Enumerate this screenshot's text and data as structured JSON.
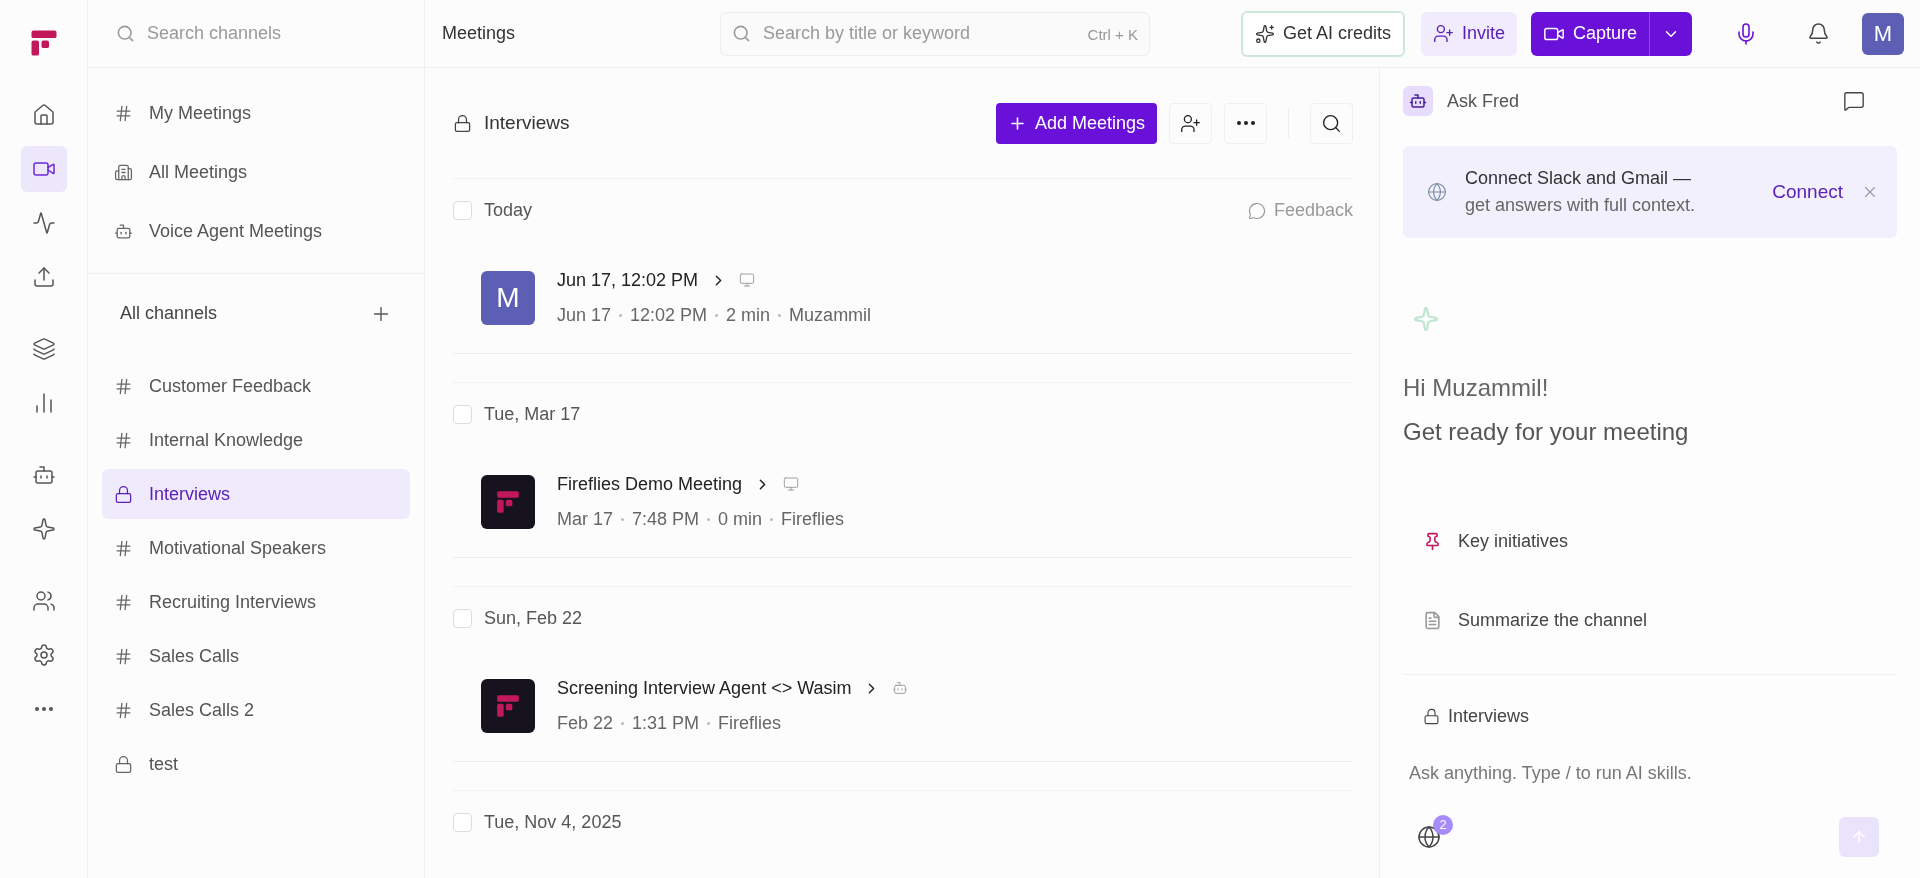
{
  "rail": [
    [
      {
        "kind": "home",
        "selected": false
      },
      {
        "kind": "video",
        "selected": true
      },
      {
        "kind": "activity",
        "selected": false
      },
      {
        "kind": "upload",
        "selected": false
      }
    ],
    [
      {
        "kind": "layers",
        "selected": false
      },
      {
        "kind": "chart",
        "selected": false
      }
    ],
    [
      {
        "kind": "bot",
        "selected": false
      },
      {
        "kind": "sparkle",
        "selected": false
      }
    ],
    [
      {
        "kind": "users",
        "selected": false
      },
      {
        "kind": "settings",
        "selected": false
      },
      {
        "kind": "more",
        "selected": false
      }
    ]
  ],
  "channel_search": {
    "placeholder": "Search channels"
  },
  "page_title": "Meetings",
  "search": {
    "placeholder": "Search by title or keyword",
    "shortcut": "Ctrl + K"
  },
  "top_actions": {
    "credits": "Get AI credits",
    "invite": "Invite",
    "capture": "Capture",
    "avatar": "M"
  },
  "sidebar": {
    "top_items": [
      {
        "kind": "hash",
        "label": "My Meetings",
        "selected": false
      },
      {
        "kind": "building",
        "label": "All Meetings",
        "selected": false
      },
      {
        "kind": "bot",
        "label": "Voice Agent Meetings",
        "selected": false
      }
    ],
    "channels_heading": "All channels",
    "channels": [
      {
        "kind": "hash",
        "label": "Customer Feedback",
        "selected": false
      },
      {
        "kind": "hash",
        "label": "Internal Knowledge",
        "selected": false
      },
      {
        "kind": "lock",
        "label": "Interviews",
        "selected": true
      },
      {
        "kind": "hash",
        "label": "Motivational Speakers",
        "selected": false
      },
      {
        "kind": "hash",
        "label": "Recruiting Interviews",
        "selected": false
      },
      {
        "kind": "hash",
        "label": "Sales Calls",
        "selected": false
      },
      {
        "kind": "hash",
        "label": "Sales Calls 2",
        "selected": false
      },
      {
        "kind": "lock",
        "label": "test",
        "selected": false
      }
    ]
  },
  "channel": {
    "title": "Interviews",
    "add_button": "Add Meetings",
    "feedback": "Feedback"
  },
  "groups": [
    {
      "date": "Today",
      "checked": false,
      "meetings": [
        {
          "avatar": {
            "kind": "letter",
            "text": "M"
          },
          "title": "Jun 17, 12:02 PM",
          "source": {
            "kind": "screen"
          },
          "meta": [
            "Jun 17",
            "12:02 PM",
            "2 min",
            "Muzammil"
          ]
        }
      ]
    },
    {
      "date": "Tue, Mar 17",
      "checked": false,
      "meetings": [
        {
          "avatar": {
            "kind": "logo"
          },
          "title": "Fireflies Demo Meeting",
          "source": {
            "kind": "screen"
          },
          "meta": [
            "Mar 17",
            "7:48 PM",
            "0 min",
            "Fireflies"
          ]
        }
      ]
    },
    {
      "date": "Sun, Feb 22",
      "checked": false,
      "meetings": [
        {
          "avatar": {
            "kind": "logo"
          },
          "title": "Screening Interview Agent <> Wasim",
          "source": {
            "kind": "bot"
          },
          "meta": [
            "Feb 22",
            "1:31 PM",
            "Fireflies"
          ]
        }
      ]
    },
    {
      "date": "Tue, Nov 4, 2025",
      "checked": false
    }
  ],
  "assistant": {
    "title": "Ask Fred",
    "banner": {
      "title": "Connect Slack and Gmail —",
      "text": "get answers with full context.",
      "action": "Connect"
    },
    "greeting": "Hi Muzammil!",
    "subtitle": "Get ready for your meeting",
    "suggestions": [
      {
        "kind": "pin",
        "label": "Key initiatives"
      },
      {
        "kind": "doc",
        "label": "Summarize the channel"
      }
    ],
    "context": "Interviews",
    "input": {
      "placeholder": "Ask anything. Type / to run AI skills."
    },
    "sources_count": "2"
  }
}
